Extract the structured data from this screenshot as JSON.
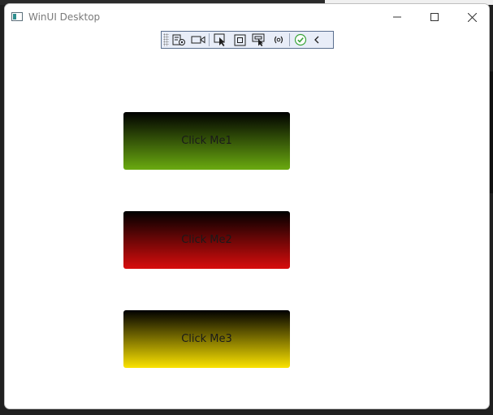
{
  "window": {
    "title": "WinUI Desktop",
    "caption_buttons": {
      "minimize_icon": "minimize-icon",
      "maximize_icon": "maximize-icon",
      "close_icon": "close-icon"
    }
  },
  "debug_toolbar": {
    "tools": [
      {
        "icon": "live-visual-tree-icon"
      },
      {
        "icon": "record-icon"
      },
      {
        "icon": "select-element-icon"
      },
      {
        "icon": "display-layout-adorners-icon"
      },
      {
        "icon": "track-focused-element-icon"
      },
      {
        "icon": "hot-reload-icon"
      },
      {
        "icon": "status-ok-icon"
      },
      {
        "icon": "collapse-chevron-icon"
      }
    ]
  },
  "buttons": [
    {
      "label": "Click Me1",
      "gradient_end": "#6aaa10"
    },
    {
      "label": "Click Me2",
      "gradient_end": "#d80d0d"
    },
    {
      "label": "Click Me3",
      "gradient_end": "#fbe300"
    }
  ],
  "colors": {
    "gradient_start": "#000000",
    "toolbar_bg": "#e8edf8",
    "toolbar_border": "#5a6f8f"
  }
}
